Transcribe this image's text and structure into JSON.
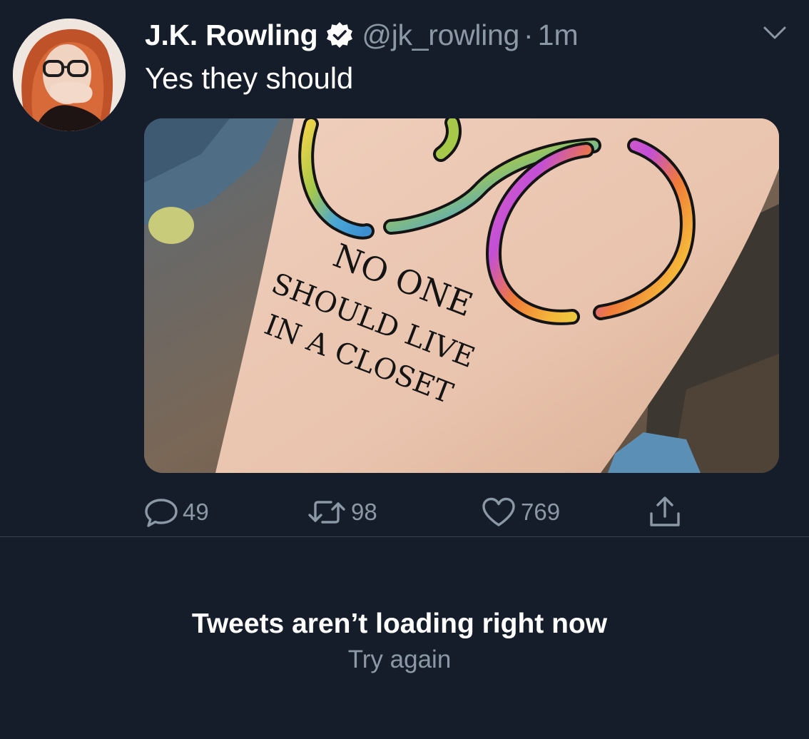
{
  "tweet": {
    "author_name": "J.K. Rowling",
    "handle": "@jk_rowling",
    "separator": "·",
    "timestamp": "1m",
    "text": "Yes they should",
    "media": {
      "tattoo_lines": [
        "NO ONE",
        "SHOULD LIVE",
        "IN A CLOSET"
      ]
    },
    "actions": {
      "replies": "49",
      "retweets": "98",
      "likes": "769"
    }
  },
  "icons": {
    "verified": "verified-badge-icon",
    "caret": "chevron-down-icon",
    "reply": "reply-icon",
    "retweet": "retweet-icon",
    "like": "heart-icon",
    "share": "share-icon"
  },
  "colors": {
    "background": "#161d2a",
    "secondary_text": "#8b98a6",
    "divider": "#38444d"
  },
  "error": {
    "title": "Tweets aren’t loading right now",
    "retry_label": "Try again"
  }
}
